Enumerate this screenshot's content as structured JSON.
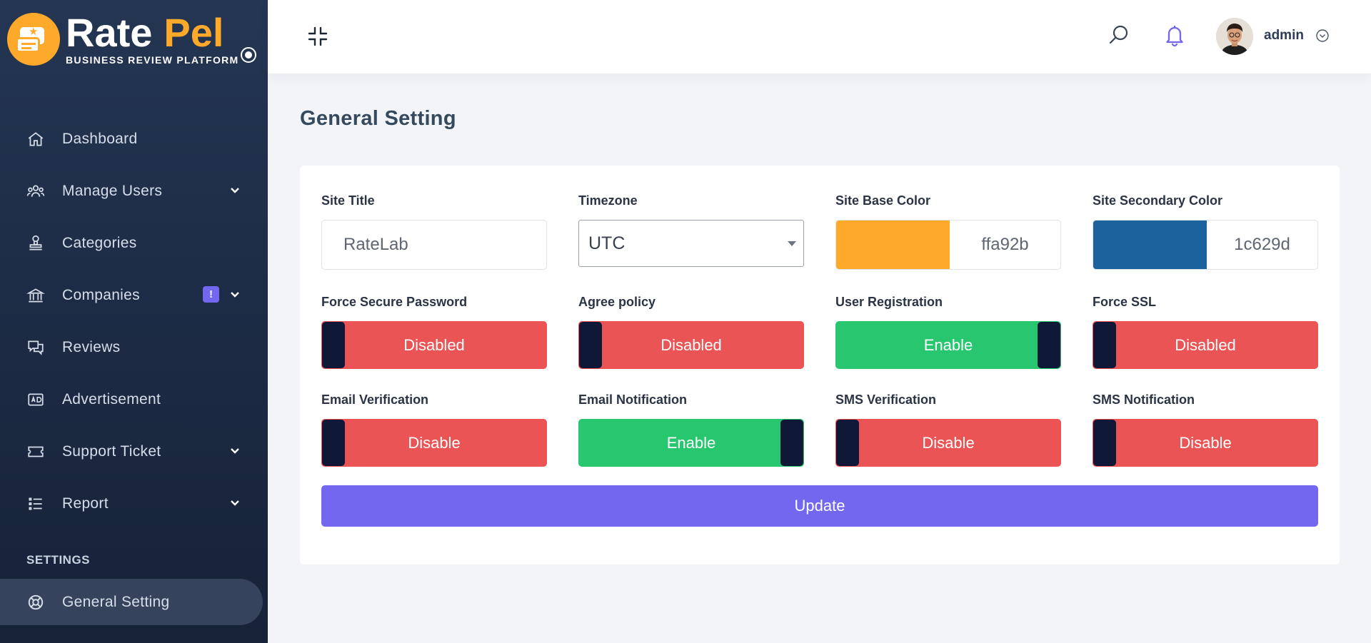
{
  "brand": {
    "name_part1": "Rate",
    "name_part2": "Pel",
    "tagline": "BUSINESS REVIEW PLATFORM",
    "accent": "#ffa92b"
  },
  "sidebar": {
    "items": [
      {
        "label": "Dashboard",
        "icon": "home-icon",
        "has_caret": false
      },
      {
        "label": "Manage Users",
        "icon": "users-icon",
        "has_caret": true
      },
      {
        "label": "Categories",
        "icon": "stamp-icon",
        "has_caret": false
      },
      {
        "label": "Companies",
        "icon": "bank-icon",
        "has_caret": true,
        "badge": "!"
      },
      {
        "label": "Reviews",
        "icon": "chat-icon",
        "has_caret": false
      },
      {
        "label": "Advertisement",
        "icon": "ad-icon",
        "has_caret": false
      },
      {
        "label": "Support Ticket",
        "icon": "ticket-icon",
        "has_caret": true
      },
      {
        "label": "Report",
        "icon": "list-icon",
        "has_caret": true
      }
    ],
    "section_title": "SETTINGS",
    "active_item": {
      "label": "General Setting",
      "icon": "lifebuoy-icon"
    }
  },
  "topbar": {
    "user_name": "admin"
  },
  "page": {
    "title": "General Setting"
  },
  "form": {
    "site_title": {
      "label": "Site Title",
      "value": "RateLab"
    },
    "timezone": {
      "label": "Timezone",
      "value": "UTC"
    },
    "base_color": {
      "label": "Site Base Color",
      "value": "ffa92b",
      "color": "#ffa92b"
    },
    "secondary_color": {
      "label": "Site Secondary Color",
      "value": "1c629d",
      "color": "#1c629d"
    },
    "toggles": [
      {
        "label": "Force Secure Password",
        "state": "Disabled",
        "on": false
      },
      {
        "label": "Agree policy",
        "state": "Disabled",
        "on": false
      },
      {
        "label": "User Registration",
        "state": "Enable",
        "on": true
      },
      {
        "label": "Force SSL",
        "state": "Disabled",
        "on": false
      },
      {
        "label": "Email Verification",
        "state": "Disable",
        "on": false
      },
      {
        "label": "Email Notification",
        "state": "Enable",
        "on": true
      },
      {
        "label": "SMS Verification",
        "state": "Disable",
        "on": false
      },
      {
        "label": "SMS Notification",
        "state": "Disable",
        "on": false
      }
    ],
    "update_label": "Update"
  },
  "colors": {
    "primary": "#7367f0",
    "success": "#28c76f",
    "danger": "#ea5455",
    "knob": "#101838"
  }
}
